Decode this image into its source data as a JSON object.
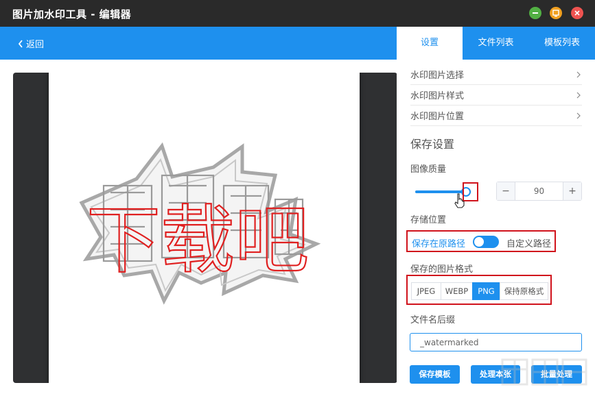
{
  "window": {
    "title": "图片加水印工具 - 编辑器"
  },
  "header": {
    "back_label": "返回"
  },
  "tabs": [
    {
      "label": "设置",
      "active": true
    },
    {
      "label": "文件列表",
      "active": false
    },
    {
      "label": "模板列表",
      "active": false
    }
  ],
  "settings_menu": [
    {
      "label": "水印图片选择"
    },
    {
      "label": "水印图片样式"
    },
    {
      "label": "水印图片位置"
    }
  ],
  "save_settings": {
    "section_title": "保存设置",
    "quality_label": "图像质量",
    "quality_value": "90",
    "quality_fraction": 0.9,
    "location_label": "存储位置",
    "location_original": "保存在原路径",
    "location_custom": "自定义路径",
    "location_toggle_on": false,
    "format_label": "保存的图片格式",
    "formats": [
      "JPEG",
      "WEBP",
      "PNG",
      "保持原格式"
    ],
    "selected_format": "PNG",
    "suffix_label": "文件名后缀",
    "suffix_value": "_watermarked"
  },
  "actions": {
    "save_template": "保存模板",
    "process_current": "处理本张",
    "batch_process": "批量处理"
  },
  "preview": {
    "watermark_text": "下载吧"
  },
  "colors": {
    "accent": "#1e90ee",
    "titlebar": "#2a2a2a",
    "highlight": "#d0121b"
  }
}
